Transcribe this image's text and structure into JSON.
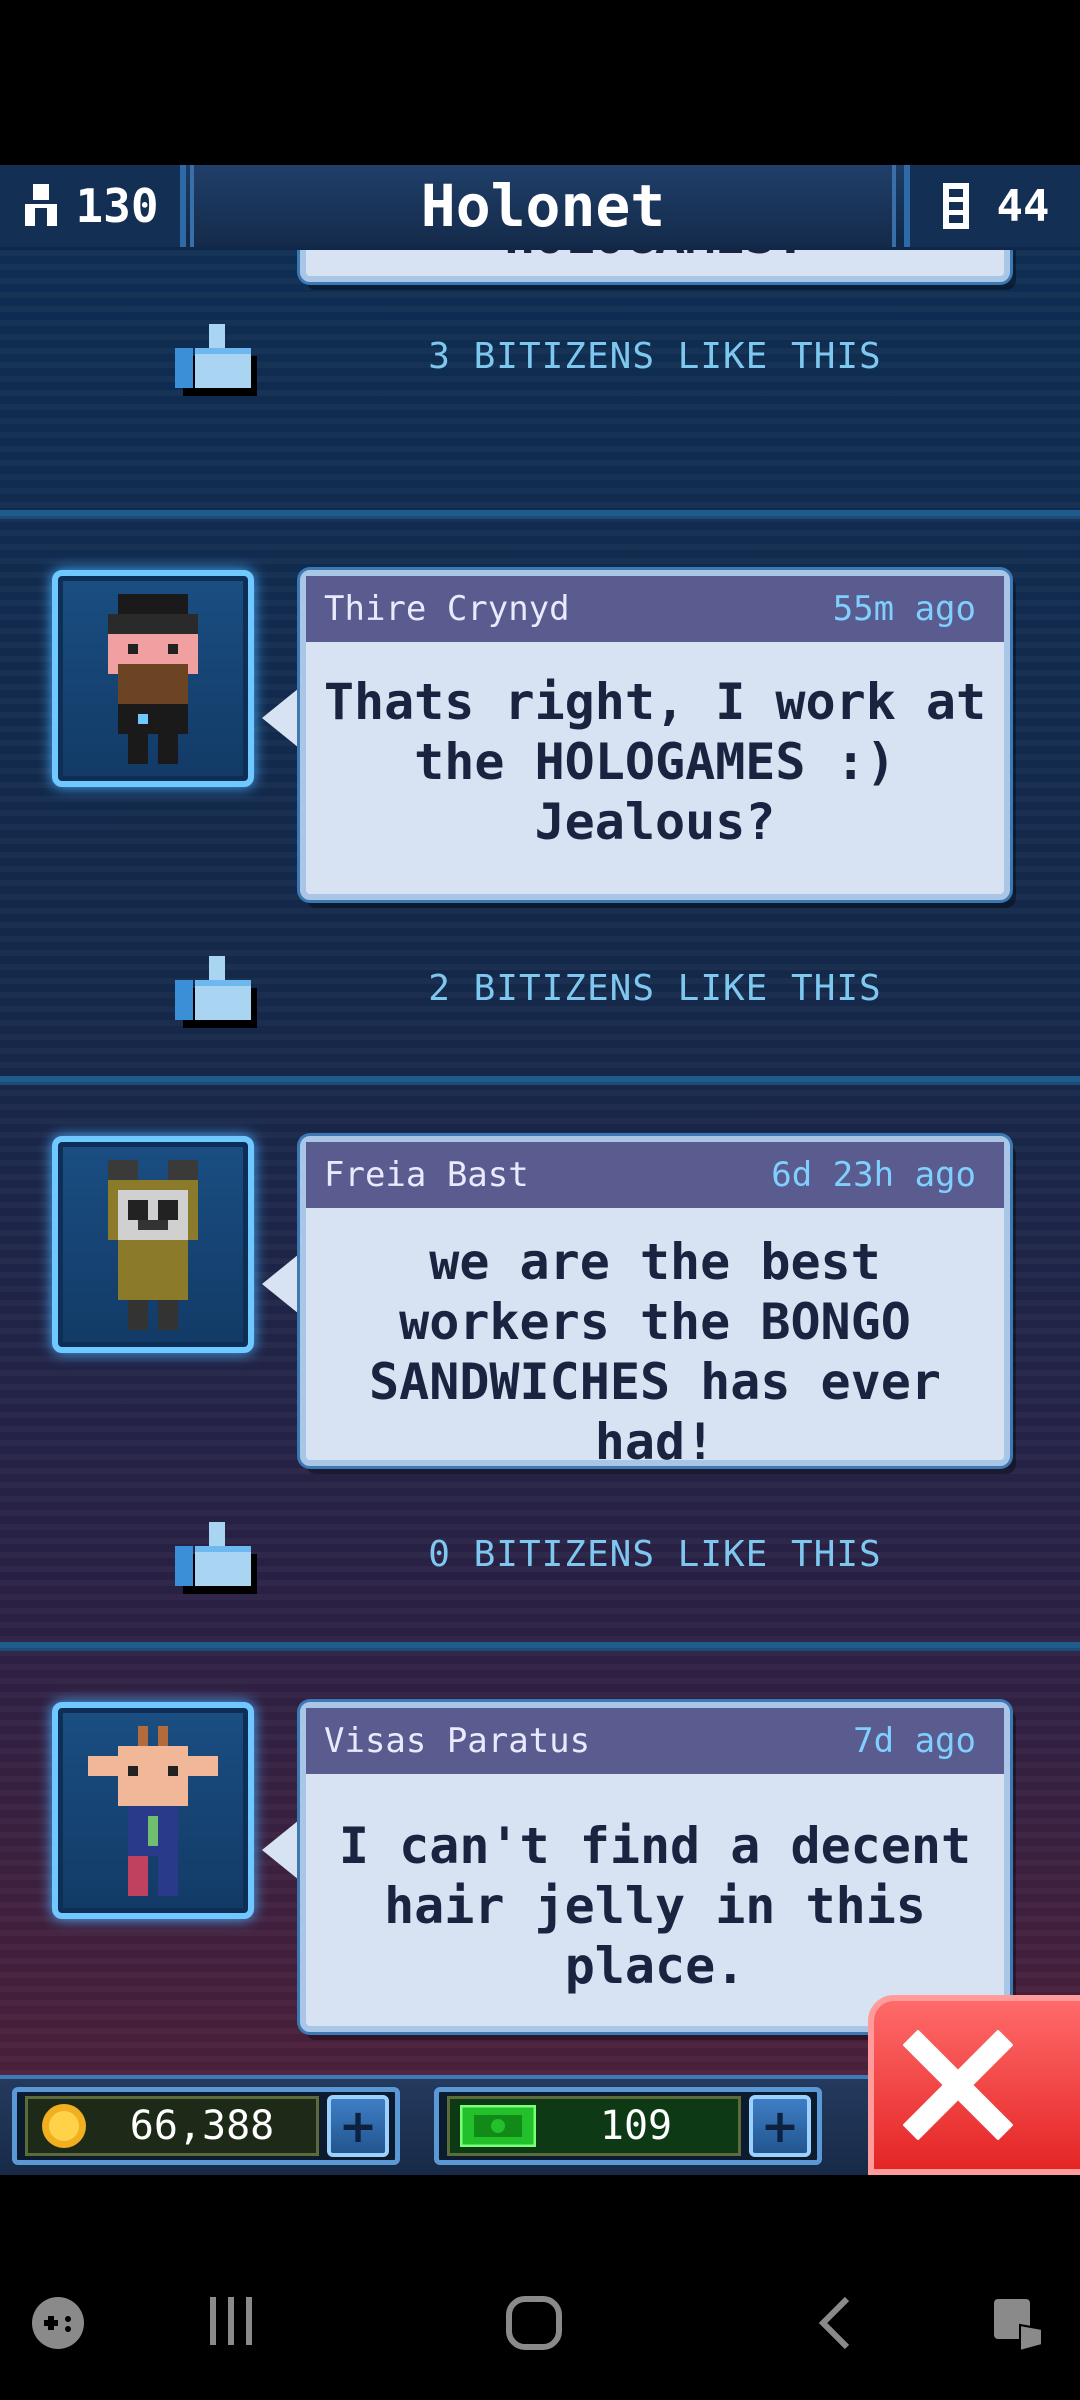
{
  "header": {
    "population": "130",
    "title": "Holonet",
    "floors": "44"
  },
  "feed": {
    "partial_post": {
      "message_tail": "HOLOGAMES.",
      "likes": "3 BITIZENS LIKE THIS"
    },
    "posts": [
      {
        "author": "Thire Crynyd",
        "time": "55m ago",
        "message": "Thats right, I work at the HOLOGAMES :) Jealous?",
        "likes": "2 BITIZENS LIKE THIS"
      },
      {
        "author": "Freia Bast",
        "time": "6d 23h ago",
        "message": "we are the best workers the BONGO SANDWICHES has ever had!",
        "likes": "0 BITIZENS LIKE THIS"
      },
      {
        "author": "Visas Paratus",
        "time": "7d ago",
        "message": "I can't find a decent hair jelly in this place.",
        "likes": ""
      }
    ]
  },
  "resources": {
    "coins": "66,388",
    "bux": "109"
  },
  "colors": {
    "accent": "#6fc8ff",
    "like_text": "#7ec8f0",
    "close": "#e52525"
  },
  "icons": [
    "person-icon",
    "elevator-icon",
    "thumbs-up-icon",
    "coin-icon",
    "bux-icon",
    "plus-icon",
    "close-icon"
  ]
}
